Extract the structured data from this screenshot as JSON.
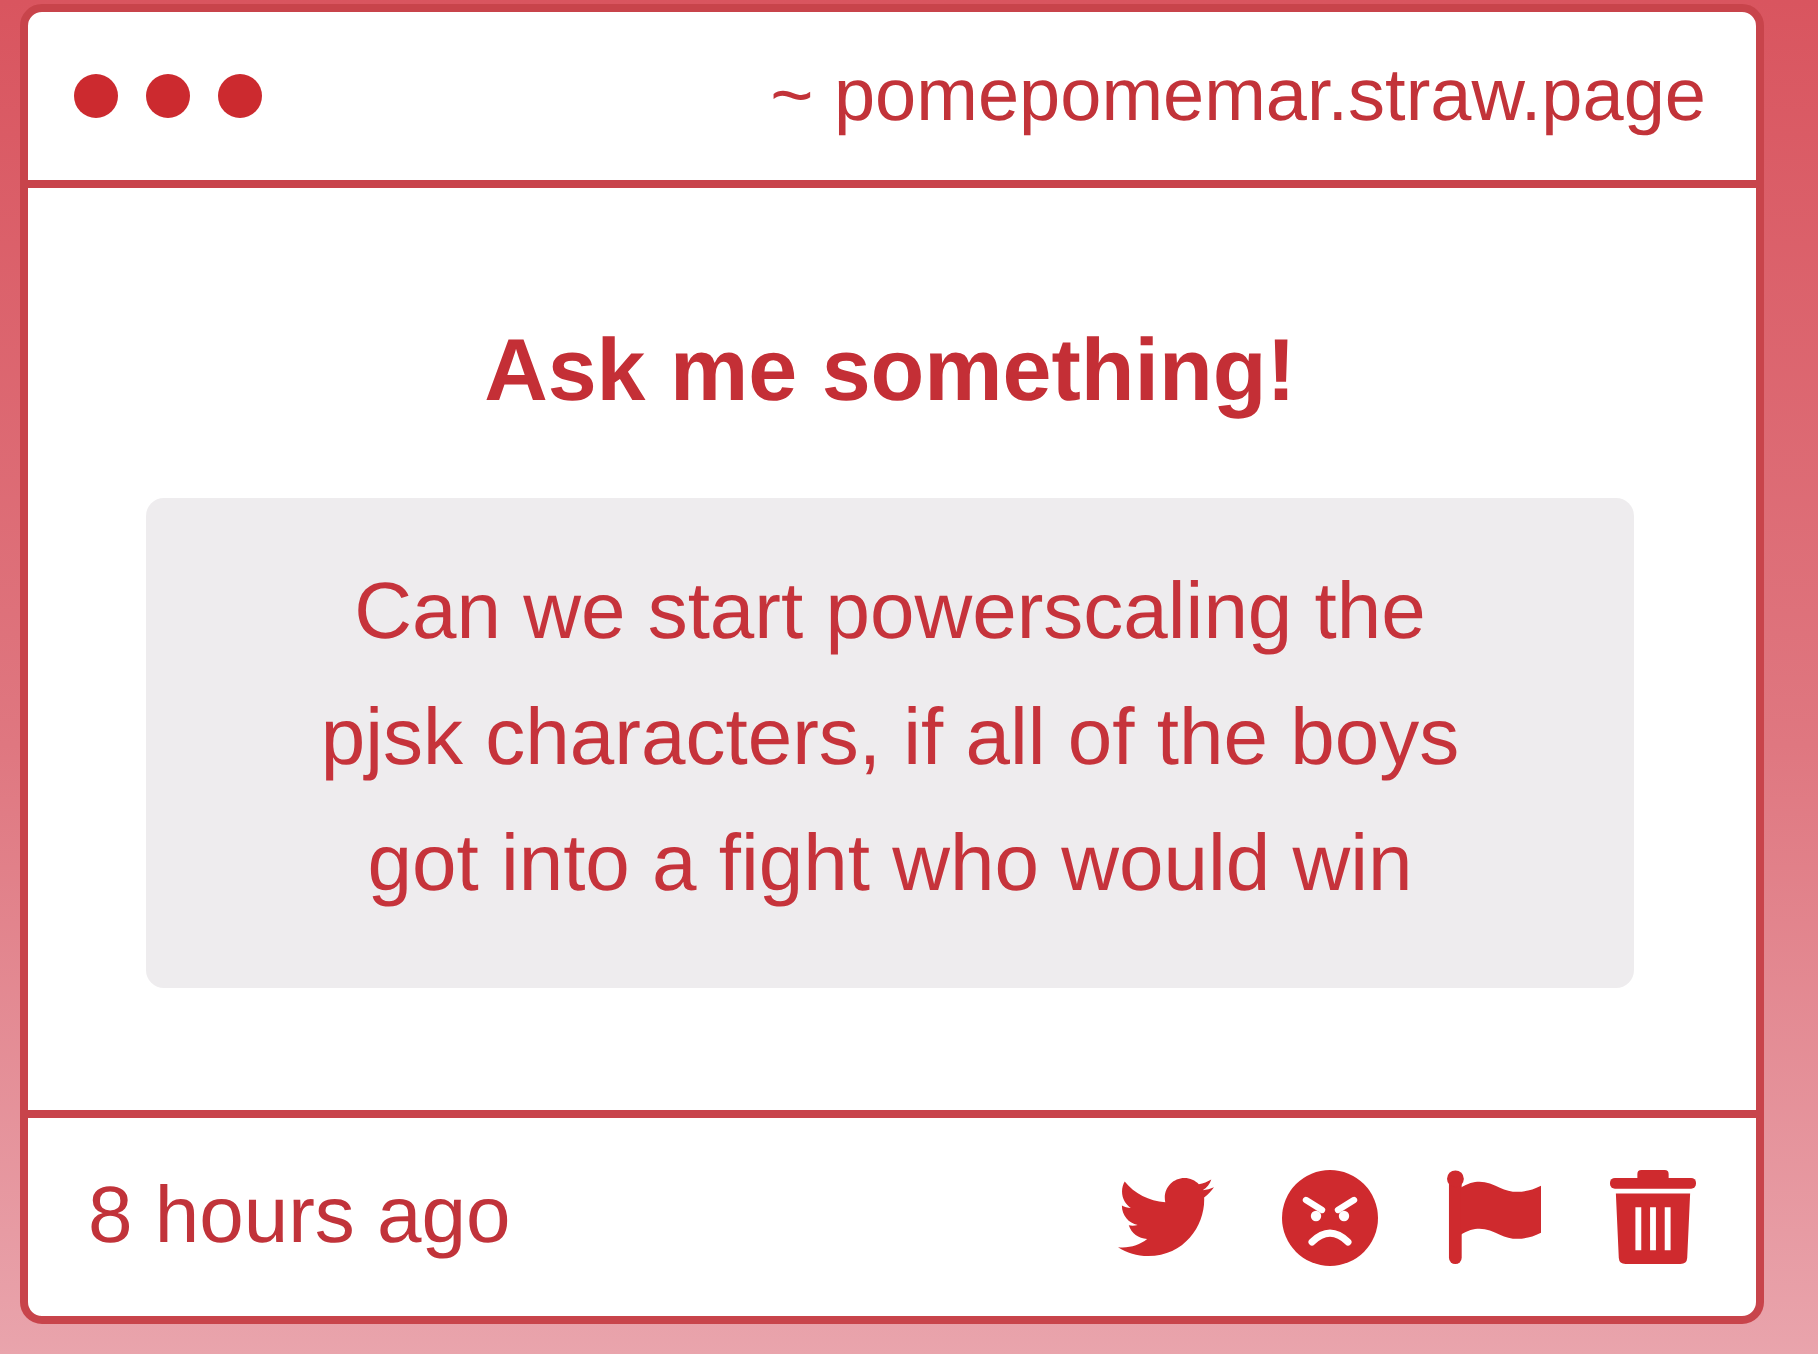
{
  "window": {
    "address": "~ pomepomemar.straw.page"
  },
  "prompt": {
    "title": "Ask me something!"
  },
  "question": {
    "text": "Can we start powerscaling the pjsk characters, if all of the boys got into a fight who would win"
  },
  "footer": {
    "time": "8 hours ago"
  }
}
